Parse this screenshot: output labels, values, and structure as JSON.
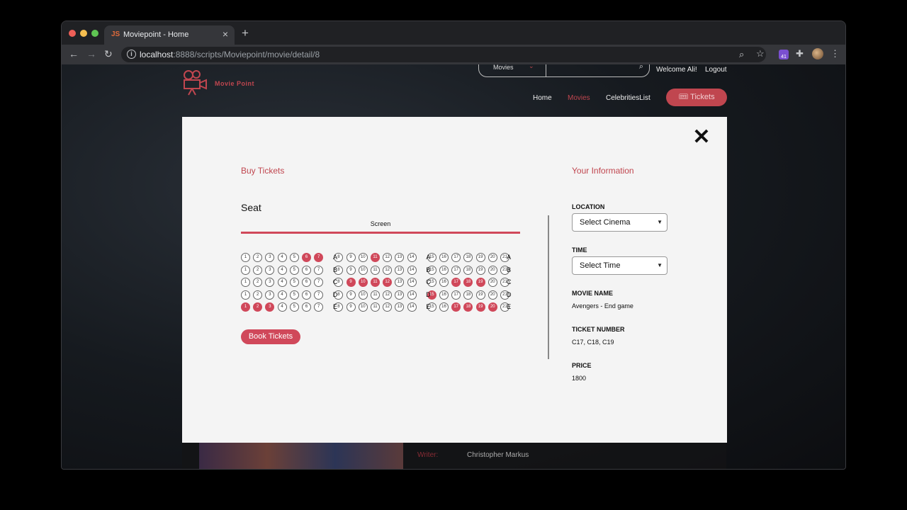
{
  "browser": {
    "tab_title": "Moviepoint - Home",
    "favicon": "JS",
    "url_host": "localhost",
    "url_rest": ":8888/scripts/Moviepoint/movie/detail/8",
    "extension_badge": "41"
  },
  "site": {
    "logo_text": "Movie Point",
    "search_category": "Movies",
    "welcome": "Welcome Ali!",
    "logout": "Logout",
    "nav_home": "Home",
    "nav_movies": "Movies",
    "nav_celebrities": "CelebritiesList",
    "tickets_button": "🎟 Tickets",
    "writer_label": "Writer:",
    "writer_value": "Christopher Markus"
  },
  "modal": {
    "buy_heading": "Buy Tickets",
    "info_heading": "Your Information",
    "seat_title": "Seat",
    "screen_label": "Screen",
    "book_button": "Book Tickets",
    "location_label": "LOCATION",
    "location_value": "Select Cinema",
    "time_label": "TIME",
    "time_value": "Select Time",
    "movie_label": "MOVIE NAME",
    "movie_value": "Avengers - End game",
    "ticket_label": "TICKET NUMBER",
    "ticket_value": "C17, C18, C19",
    "price_label": "PRICE",
    "price_value": "1800"
  },
  "seating": {
    "rows": [
      "A",
      "B",
      "C",
      "D",
      "E"
    ],
    "seats_per_row": 21,
    "taken": {
      "A": [
        6,
        7,
        11
      ],
      "B": [],
      "C": [
        9,
        10,
        11,
        12,
        17,
        18,
        19
      ],
      "D": [
        15
      ],
      "E": [
        1,
        2,
        3,
        17,
        18,
        19,
        20
      ]
    },
    "taken_color": "#d0485a"
  }
}
